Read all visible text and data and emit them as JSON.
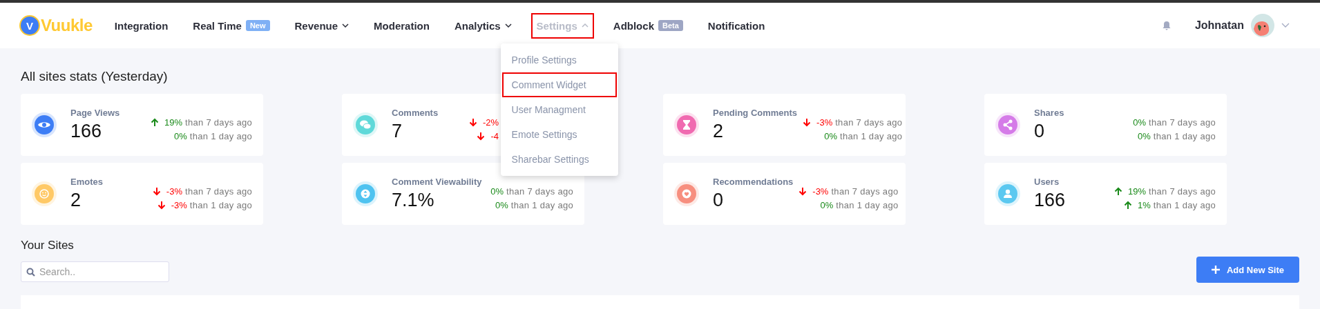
{
  "header": {
    "logo": {
      "mark": "V",
      "text": "Vuukle"
    },
    "nav": [
      {
        "label": "Integration",
        "selected": false,
        "has_menu": false,
        "highlighted": false
      },
      {
        "label": "Real Time",
        "selected": false,
        "has_menu": false,
        "highlighted": false,
        "badge": {
          "text": "New",
          "color": "#7fb0f5"
        }
      },
      {
        "label": "Revenue",
        "selected": false,
        "has_menu": true,
        "highlighted": false
      },
      {
        "label": "Moderation",
        "selected": false,
        "has_menu": false,
        "highlighted": false
      },
      {
        "label": "Analytics",
        "selected": false,
        "has_menu": true,
        "highlighted": false
      },
      {
        "label": "Settings",
        "selected": true,
        "has_menu": true,
        "highlighted": true,
        "menu": [
          {
            "label": "Profile Settings",
            "highlighted": false
          },
          {
            "label": "Comment Widget",
            "highlighted": true
          },
          {
            "label": "User Managment",
            "highlighted": false
          },
          {
            "label": "Emote Settings",
            "highlighted": false
          },
          {
            "label": "Sharebar Settings",
            "highlighted": false
          }
        ]
      },
      {
        "label": "Adblock",
        "selected": false,
        "has_menu": false,
        "highlighted": false,
        "badge": {
          "text": "Beta",
          "color": "#9ea6c4"
        }
      },
      {
        "label": "Notification",
        "selected": false,
        "has_menu": false,
        "highlighted": false
      }
    ],
    "user": {
      "name": "Johnatan"
    }
  },
  "stats": {
    "title": "All sites stats (Yesterday)",
    "cards": [
      {
        "label": "Page Views",
        "value": "166",
        "kind": "eye",
        "color": "#3d7df5",
        "changes": [
          {
            "kind": "up",
            "pct": "19%",
            "suffix": "than 7 days ago"
          },
          {
            "kind": "flat",
            "pct": "0%",
            "suffix": "than 1 day ago"
          }
        ]
      },
      {
        "label": "Comments",
        "value": "7",
        "kind": "chat",
        "color": "#5fd9d9",
        "changes": [
          {
            "kind": "down",
            "pct": "-2%"
          },
          {
            "kind": "down",
            "pct": "-4"
          }
        ]
      },
      {
        "label": "Pending Comments",
        "value": "2",
        "kind": "hourglass",
        "color": "#f06ab0",
        "changes": [
          {
            "kind": "down",
            "pct": "-3%",
            "suffix": "than 7 days ago"
          },
          {
            "kind": "flat",
            "pct": "0%",
            "suffix": "than 1 day ago"
          }
        ]
      },
      {
        "label": "Shares",
        "value": "0",
        "kind": "share",
        "color": "#d57be8",
        "changes": [
          {
            "kind": "flat",
            "pct": "0%",
            "suffix": "than 7 days ago"
          },
          {
            "kind": "flat",
            "pct": "0%",
            "suffix": "than 1 day ago"
          }
        ]
      },
      {
        "label": "Emotes",
        "value": "2",
        "kind": "smile",
        "color": "#ffc966",
        "changes": [
          {
            "kind": "down",
            "pct": "-3%",
            "suffix": "than 7 days ago"
          },
          {
            "kind": "down",
            "pct": "-3%",
            "suffix": "than 1 day ago"
          }
        ]
      },
      {
        "label": "Comment Viewability",
        "value": "7.1%",
        "kind": "updown",
        "color": "#4fc3f0",
        "changes": [
          {
            "kind": "flat",
            "pct": "0%",
            "suffix": "than 7 days ago"
          },
          {
            "kind": "flat",
            "pct": "0%",
            "suffix": "than 1 day ago"
          }
        ]
      },
      {
        "label": "Recommendations",
        "value": "0",
        "kind": "heart",
        "color": "#f78f7f",
        "changes": [
          {
            "kind": "down",
            "pct": "-3%",
            "suffix": "than 7 days ago"
          },
          {
            "kind": "flat",
            "pct": "0%",
            "suffix": "than 1 day ago"
          }
        ]
      },
      {
        "label": "Users",
        "value": "166",
        "kind": "user",
        "color": "#5bc8f0",
        "changes": [
          {
            "kind": "up",
            "pct": "19%",
            "suffix": "than 7 days ago"
          },
          {
            "kind": "up",
            "pct": "1%",
            "suffix": "than 1 day ago"
          }
        ]
      }
    ]
  },
  "sites": {
    "title": "Your Sites",
    "search": {
      "placeholder": "Search.."
    },
    "add_button": "Add New Site"
  }
}
